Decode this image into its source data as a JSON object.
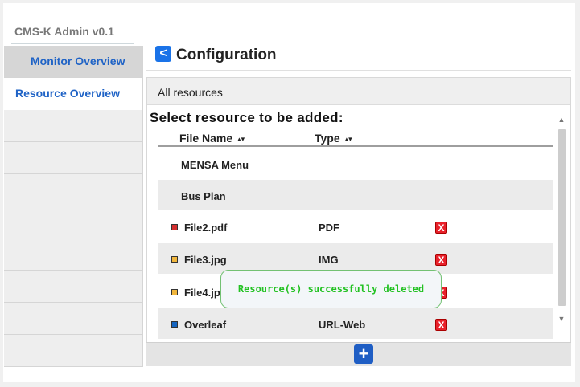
{
  "app": {
    "title": "CMS-K Admin v0.1"
  },
  "sidebar": {
    "items": [
      {
        "label": "Monitor Overview"
      },
      {
        "label": "Resource Overview"
      }
    ]
  },
  "page": {
    "title": "Configuration",
    "back_icon": "chevron-left-icon"
  },
  "panel": {
    "header": "All resources",
    "heading": "Select resource to be added:",
    "columns": {
      "name": "File Name",
      "type": "Type",
      "sort_icon": "▴▾"
    },
    "rows": [
      {
        "name": "MENSA Menu",
        "type": "",
        "color": ""
      },
      {
        "name": "Bus Plan",
        "type": "",
        "color": ""
      },
      {
        "name": "File2.pdf",
        "type": "PDF",
        "color": "#d32f2f"
      },
      {
        "name": "File3.jpg",
        "type": "IMG",
        "color": "#f0b63d"
      },
      {
        "name": "File4.jp",
        "type": "",
        "color": "#f0b63d"
      },
      {
        "name": "Overleaf",
        "type": "URL-Web",
        "color": "#1565c0"
      }
    ],
    "delete_label": "X"
  },
  "footer": {
    "add_label": "+"
  },
  "toast": {
    "message": "Resource(s) successfully deleted"
  },
  "colors": {
    "accent": "#1a73e8",
    "delete": "#e8212b",
    "success": "#22c122"
  }
}
